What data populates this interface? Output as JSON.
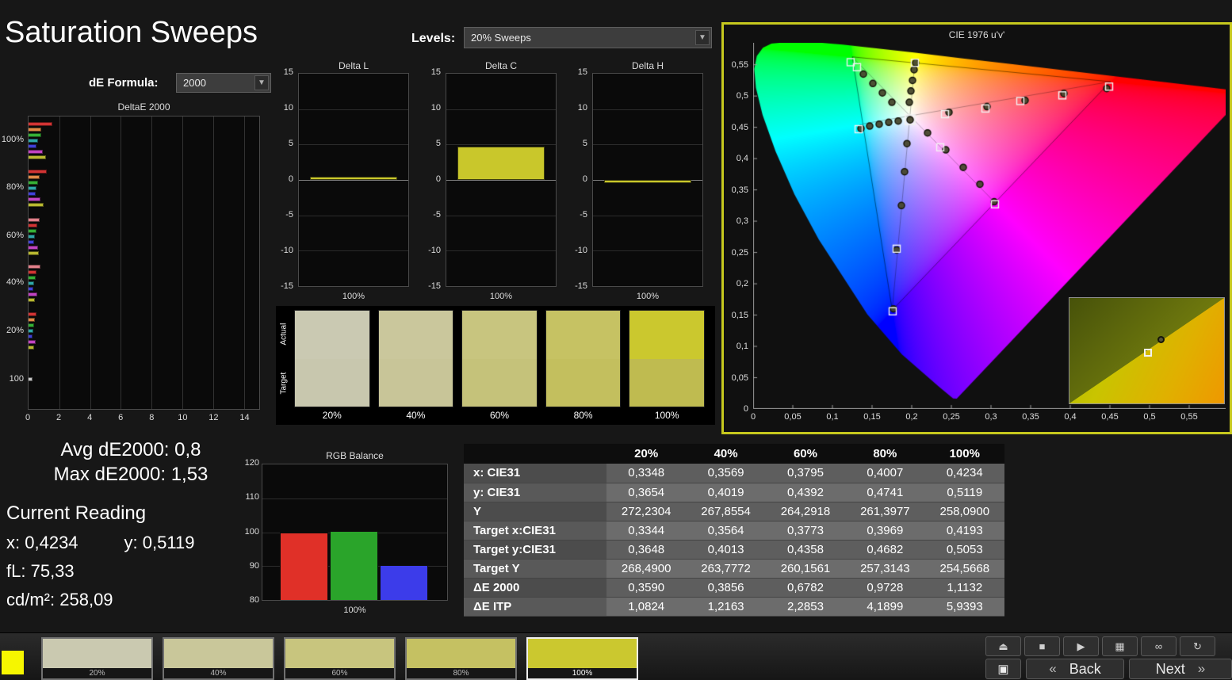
{
  "header": {
    "title": "Saturation Sweeps"
  },
  "icons": {
    "chevron_down": "▼"
  },
  "de_formula": {
    "label": "dE Formula:",
    "value": "2000"
  },
  "levels": {
    "label": "Levels:",
    "value": "20% Sweeps"
  },
  "deltae_chart": {
    "title": "DeltaE 2000",
    "x_ticks": [
      "0",
      "2",
      "4",
      "6",
      "8",
      "10",
      "12",
      "14"
    ],
    "x_max": 15,
    "groups": [
      {
        "label": "100%",
        "bars": [
          {
            "c": "#d23434",
            "v": 1.53
          },
          {
            "c": "#e08a46",
            "v": 0.85
          },
          {
            "c": "#36b036",
            "v": 0.8
          },
          {
            "c": "#2fa8a8",
            "v": 0.62
          },
          {
            "c": "#4242d8",
            "v": 0.5
          },
          {
            "c": "#c244c2",
            "v": 0.95
          },
          {
            "c": "#b9b931",
            "v": 1.11
          }
        ]
      },
      {
        "label": "80%",
        "bars": [
          {
            "c": "#d23434",
            "v": 1.2
          },
          {
            "c": "#e08a46",
            "v": 0.72
          },
          {
            "c": "#36b036",
            "v": 0.6
          },
          {
            "c": "#2fa8a8",
            "v": 0.5
          },
          {
            "c": "#4242d8",
            "v": 0.45
          },
          {
            "c": "#c244c2",
            "v": 0.75
          },
          {
            "c": "#b9b931",
            "v": 0.97
          }
        ]
      },
      {
        "label": "60%",
        "bars": [
          {
            "c": "#e2808a",
            "v": 0.7
          },
          {
            "c": "#d23434",
            "v": 0.55
          },
          {
            "c": "#36b036",
            "v": 0.5
          },
          {
            "c": "#2fa8a8",
            "v": 0.42
          },
          {
            "c": "#4242d8",
            "v": 0.35
          },
          {
            "c": "#c244c2",
            "v": 0.6
          },
          {
            "c": "#b9b931",
            "v": 0.68
          }
        ]
      },
      {
        "label": "40%",
        "bars": [
          {
            "c": "#e2808a",
            "v": 0.75
          },
          {
            "c": "#d23434",
            "v": 0.5
          },
          {
            "c": "#36b036",
            "v": 0.45
          },
          {
            "c": "#2fa8a8",
            "v": 0.38
          },
          {
            "c": "#4242d8",
            "v": 0.32
          },
          {
            "c": "#c244c2",
            "v": 0.55
          },
          {
            "c": "#b9b931",
            "v": 0.39
          }
        ]
      },
      {
        "label": "20%",
        "bars": [
          {
            "c": "#d23434",
            "v": 0.5
          },
          {
            "c": "#e08a46",
            "v": 0.4
          },
          {
            "c": "#36b036",
            "v": 0.36
          },
          {
            "c": "#2fa8a8",
            "v": 0.3
          },
          {
            "c": "#4242d8",
            "v": 0.28
          },
          {
            "c": "#c244c2",
            "v": 0.45
          },
          {
            "c": "#b9b931",
            "v": 0.36
          }
        ]
      },
      {
        "label": "100",
        "bars": [
          {
            "c": "#c8c8c8",
            "v": 0.25
          }
        ]
      }
    ]
  },
  "delta_y_ticks": [
    "15",
    "10",
    "5",
    "0",
    "-5",
    "-10",
    "-15"
  ],
  "delta_charts": [
    {
      "title": "Delta L",
      "value": 0.5,
      "x_label": "100%"
    },
    {
      "title": "Delta C",
      "value": 4.7,
      "x_label": "100%"
    },
    {
      "title": "Delta H",
      "value": -0.4,
      "x_label": "100%"
    }
  ],
  "swatch_strip": {
    "row_labels": [
      "Actual",
      "Target"
    ],
    "swatches": [
      {
        "label": "20%",
        "actual": "#cac9b2",
        "target": "#c8c7ae"
      },
      {
        "label": "40%",
        "actual": "#cac79c",
        "target": "#c8c598"
      },
      {
        "label": "60%",
        "actual": "#c8c57f",
        "target": "#c5c27a"
      },
      {
        "label": "80%",
        "actual": "#c6c263",
        "target": "#c3bf5e"
      },
      {
        "label": "100%",
        "actual": "#cbc82e",
        "target": "#bfbb50"
      }
    ]
  },
  "cie": {
    "title": "CIE 1976 u'v'",
    "border_color": "#c6c81e",
    "x_ticks": [
      "0",
      "0,05",
      "0,1",
      "0,15",
      "0,2",
      "0,25",
      "0,3",
      "0,35",
      "0,4",
      "0,45",
      "0,5",
      "0,55"
    ],
    "y_ticks": [
      "0",
      "0,05",
      "0,1",
      "0,15",
      "0,2",
      "0,25",
      "0,3",
      "0,35",
      "0,4",
      "0,45",
      "0,5",
      "0,55"
    ],
    "squares": [
      [
        0.123,
        0.554
      ],
      [
        0.131,
        0.546
      ],
      [
        0.204,
        0.553
      ],
      [
        0.133,
        0.447
      ],
      [
        0.176,
        0.156
      ],
      [
        0.181,
        0.256
      ],
      [
        0.449,
        0.515
      ],
      [
        0.39,
        0.501
      ],
      [
        0.337,
        0.492
      ],
      [
        0.293,
        0.48
      ],
      [
        0.242,
        0.471
      ],
      [
        0.305,
        0.327
      ],
      [
        0.236,
        0.418
      ]
    ],
    "circles": [
      [
        0.197,
        0.49
      ],
      [
        0.199,
        0.508
      ],
      [
        0.201,
        0.525
      ],
      [
        0.203,
        0.542
      ],
      [
        0.205,
        0.553
      ],
      [
        0.139,
        0.535
      ],
      [
        0.151,
        0.52
      ],
      [
        0.163,
        0.505
      ],
      [
        0.175,
        0.49
      ],
      [
        0.136,
        0.448
      ],
      [
        0.147,
        0.452
      ],
      [
        0.159,
        0.455
      ],
      [
        0.171,
        0.458
      ],
      [
        0.183,
        0.46
      ],
      [
        0.247,
        0.474
      ],
      [
        0.295,
        0.483
      ],
      [
        0.343,
        0.493
      ],
      [
        0.392,
        0.504
      ],
      [
        0.446,
        0.512
      ],
      [
        0.22,
        0.441
      ],
      [
        0.243,
        0.414
      ],
      [
        0.265,
        0.386
      ],
      [
        0.286,
        0.359
      ],
      [
        0.304,
        0.331
      ],
      [
        0.194,
        0.424
      ],
      [
        0.191,
        0.379
      ],
      [
        0.187,
        0.325
      ],
      [
        0.181,
        0.254
      ],
      [
        0.177,
        0.16
      ]
    ],
    "current": [
      0.198,
      0.462
    ]
  },
  "stats": {
    "avg_label": "Avg dE2000:",
    "avg_value": "0,8",
    "max_label": "Max dE2000:",
    "max_value": "1,53",
    "heading": "Current Reading",
    "x_label": "x:",
    "x_value": "0,4234",
    "y_label": "y:",
    "y_value": "0,5119",
    "fl_label": "fL:",
    "fl_value": "75,33",
    "cd_label": "cd/m²:",
    "cd_value": "258,09"
  },
  "rgb_balance": {
    "title": "RGB Balance",
    "y_ticks": [
      "120",
      "110",
      "100",
      "90",
      "80"
    ],
    "ymin": 80,
    "ymax": 120,
    "bars": [
      {
        "name": "red",
        "value": 100.0,
        "color": "#e03028"
      },
      {
        "name": "green",
        "value": 100.4,
        "color": "#2aa42a"
      },
      {
        "name": "blue",
        "value": 90.2,
        "color": "#3c3cea"
      }
    ],
    "x_label": "100%"
  },
  "table": {
    "columns": [
      "",
      "20%",
      "40%",
      "60%",
      "80%",
      "100%"
    ],
    "rows": [
      {
        "label": "x: CIE31",
        "values": [
          "0,3348",
          "0,3569",
          "0,3795",
          "0,4007",
          "0,4234"
        ]
      },
      {
        "label": "y: CIE31",
        "values": [
          "0,3654",
          "0,4019",
          "0,4392",
          "0,4741",
          "0,5119"
        ]
      },
      {
        "label": "Y",
        "values": [
          "272,2304",
          "267,8554",
          "264,2918",
          "261,3977",
          "258,0900"
        ]
      },
      {
        "label": "Target x:CIE31",
        "values": [
          "0,3344",
          "0,3564",
          "0,3773",
          "0,3969",
          "0,4193"
        ]
      },
      {
        "label": "Target y:CIE31",
        "values": [
          "0,3648",
          "0,4013",
          "0,4358",
          "0,4682",
          "0,5053"
        ]
      },
      {
        "label": "Target Y",
        "values": [
          "268,4900",
          "263,7772",
          "260,1561",
          "257,3143",
          "254,5668"
        ]
      },
      {
        "label": "ΔE 2000",
        "values": [
          "0,3590",
          "0,3856",
          "0,6782",
          "0,9728",
          "1,1132"
        ]
      },
      {
        "label": "ΔE ITP",
        "values": [
          "1,0824",
          "1,2163",
          "2,2853",
          "4,1899",
          "5,9393"
        ]
      }
    ]
  },
  "bottom_bar": {
    "current_color": "#f6f600",
    "patches": [
      {
        "label": "20%",
        "color": "#cac9b0",
        "active": false
      },
      {
        "label": "40%",
        "color": "#c9c79a",
        "active": false
      },
      {
        "label": "60%",
        "color": "#c8c57e",
        "active": false
      },
      {
        "label": "80%",
        "color": "#c5c162",
        "active": false
      },
      {
        "label": "100%",
        "color": "#cbc82f",
        "active": true
      }
    ],
    "transport": [
      {
        "name": "eject-button",
        "icon": "eject-icon",
        "glyph": "⏏"
      },
      {
        "name": "stop-button",
        "icon": "stop-icon",
        "glyph": "■"
      },
      {
        "name": "play-button",
        "icon": "play-icon",
        "glyph": "▶"
      },
      {
        "name": "pattern-button",
        "icon": "pattern-icon",
        "glyph": "▦"
      },
      {
        "name": "loop-button",
        "icon": "infinity-icon",
        "glyph": "∞"
      },
      {
        "name": "refresh-button",
        "icon": "refresh-icon",
        "glyph": "↻"
      }
    ],
    "window_button_glyph": "▣",
    "back": {
      "chevron": "«",
      "label": "Back"
    },
    "next": {
      "label": "Next",
      "chevron": "»"
    }
  }
}
